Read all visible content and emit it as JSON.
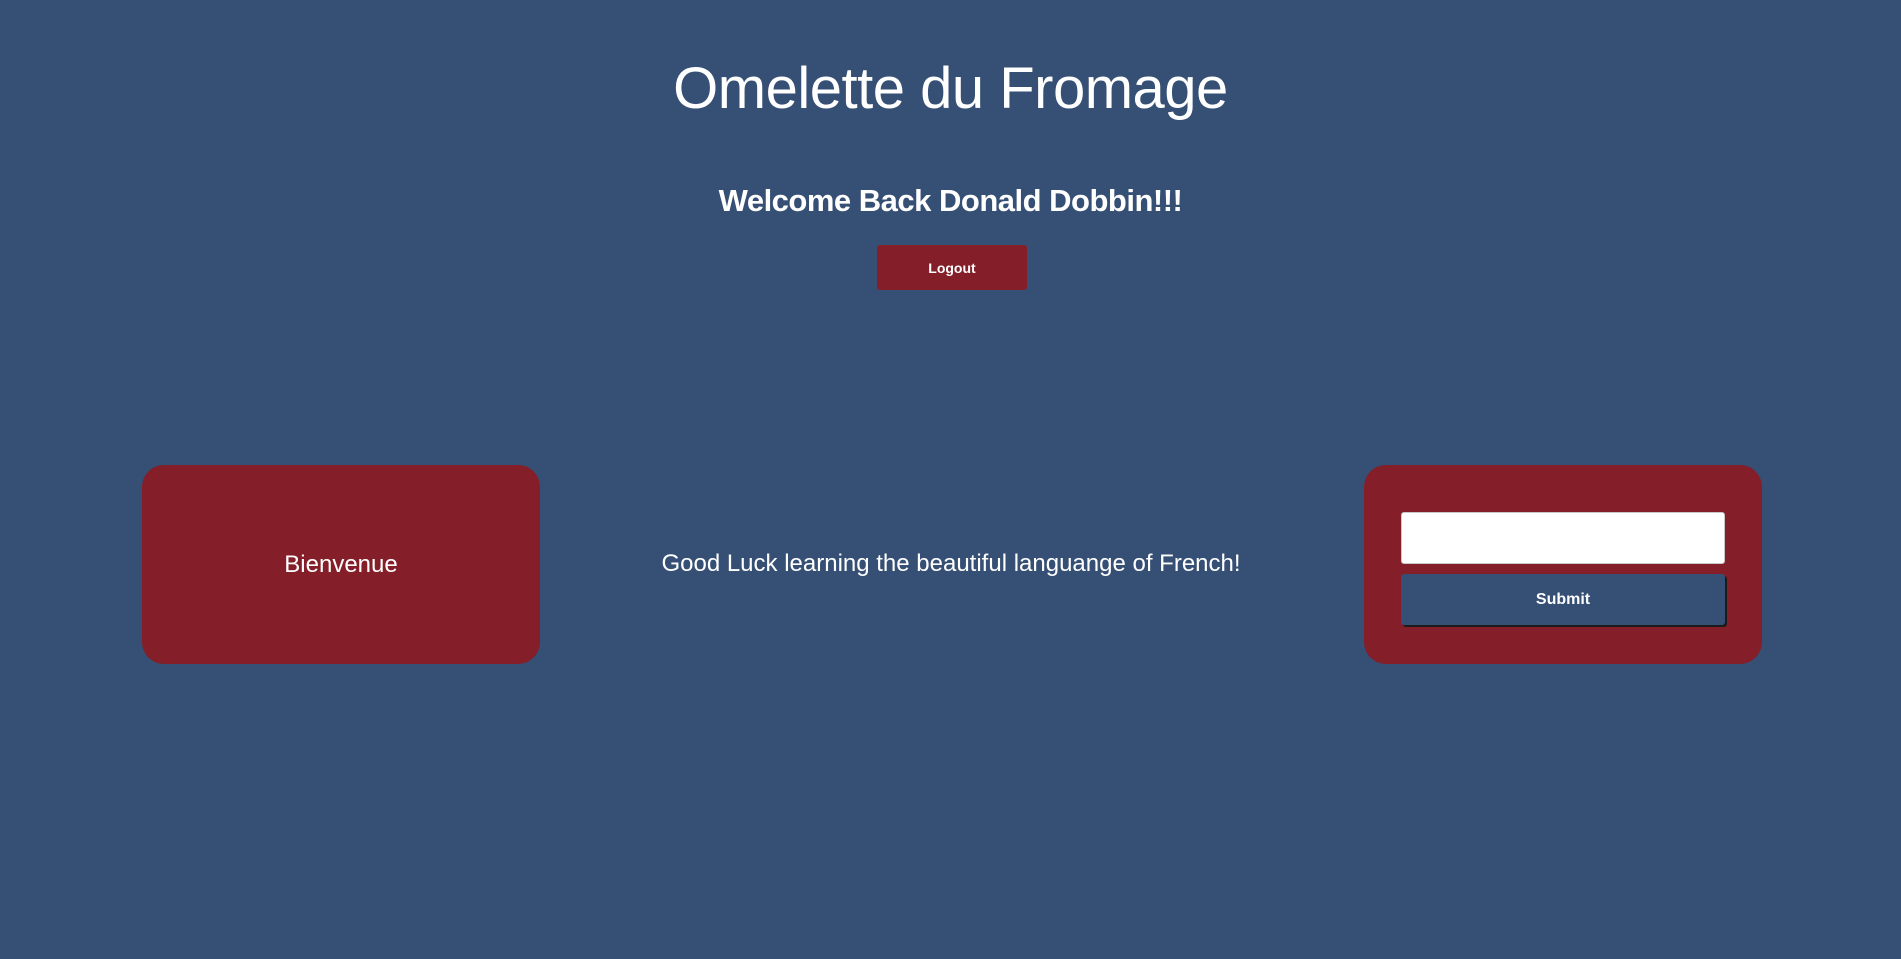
{
  "header": {
    "title": "Omelette du Fromage",
    "welcome": "Welcome Back Donald Dobbin!!!",
    "logout_label": "Logout"
  },
  "main": {
    "prompt_word": "Bienvenue",
    "message": "Good Luck learning the beautiful languange of French!",
    "answer_value": "",
    "answer_placeholder": "",
    "submit_label": "Submit"
  },
  "colors": {
    "background": "#364f74",
    "accent": "#841e28",
    "text": "#ffffff"
  }
}
